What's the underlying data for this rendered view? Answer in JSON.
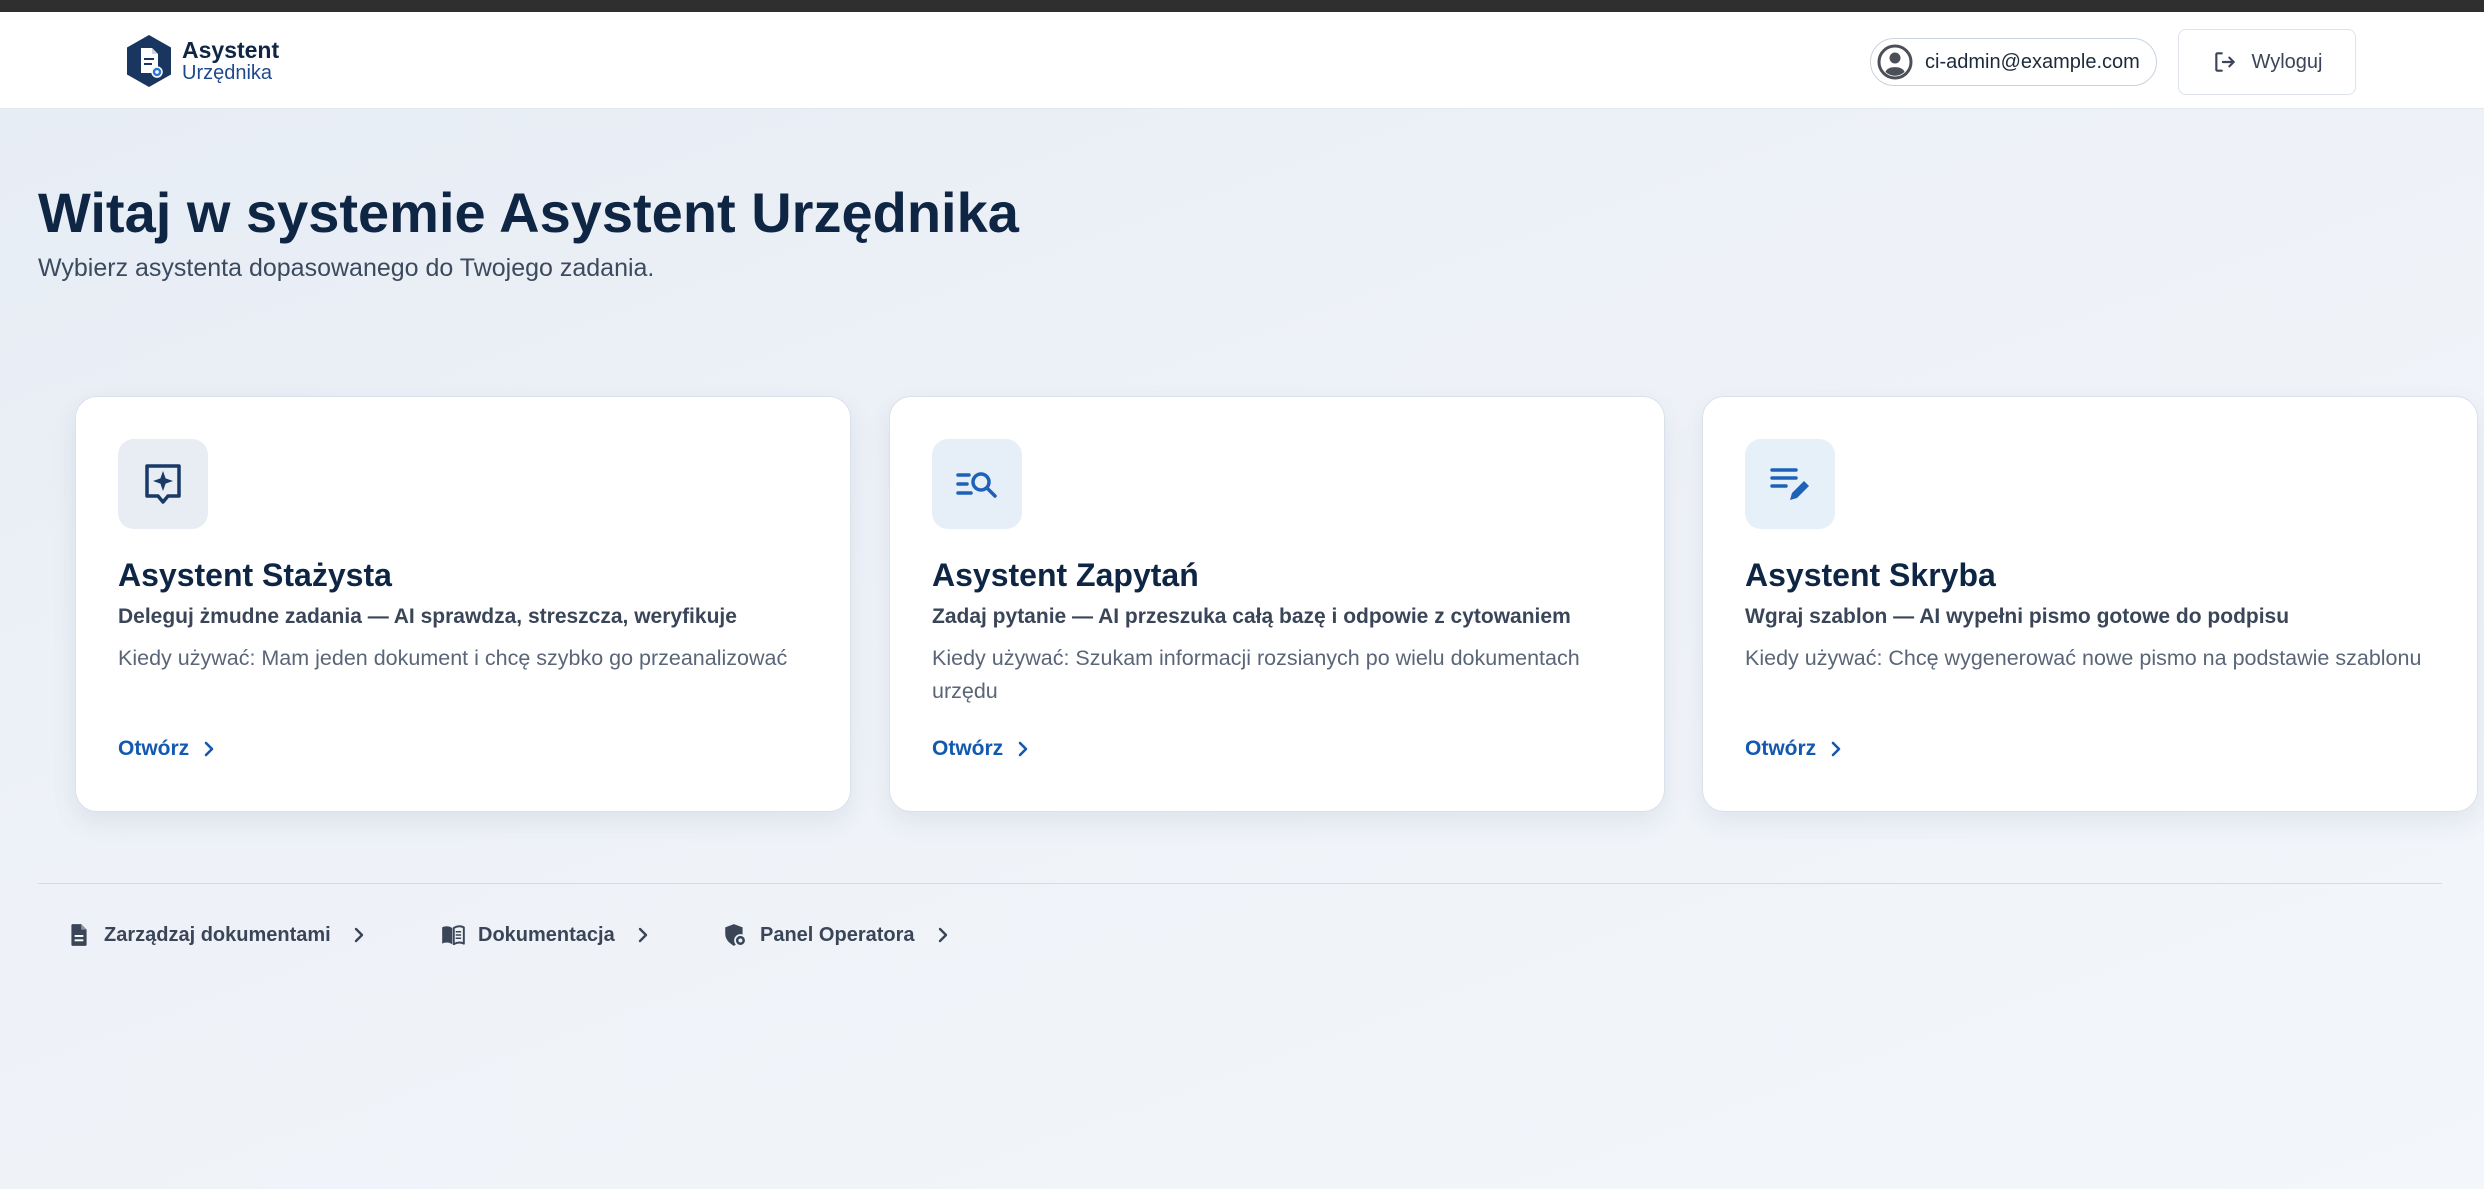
{
  "app": {
    "logo_line1": "Asystent",
    "logo_line2": "Urzędnika"
  },
  "header": {
    "user_email": "ci-admin@example.com",
    "logout_label": "Wyloguj"
  },
  "hero": {
    "title": "Witaj w systemie Asystent Urzędnika",
    "subtitle": "Wybierz asystenta dopasowanego do Twojego zadania."
  },
  "cards": [
    {
      "icon": "sparkle-bookmark-icon",
      "title": "Asystent Stażysta",
      "tagline": "Deleguj żmudne zadania — AI sprawdza, streszcza, weryfikuje",
      "description": "Kiedy używać: Mam jeden dokument i chcę szybko go przeanalizować",
      "open_label": "Otwórz"
    },
    {
      "icon": "search-list-icon",
      "title": "Asystent Zapytań",
      "tagline": "Zadaj pytanie — AI przeszuka całą bazę i odpowie z cytowaniem",
      "description": "Kiedy używać: Szukam informacji rozsianych po wielu dokumentach urzędu",
      "open_label": "Otwórz"
    },
    {
      "icon": "edit-note-icon",
      "title": "Asystent Skryba",
      "tagline": "Wgraj szablon — AI wypełni pismo gotowe do podpisu",
      "description": "Kiedy używać: Chcę wygenerować nowe pismo na podstawie szablonu",
      "open_label": "Otwórz"
    }
  ],
  "footer_links": [
    {
      "icon": "document-icon",
      "label": "Zarządzaj dokumentami"
    },
    {
      "icon": "book-icon",
      "label": "Dokumentacja"
    },
    {
      "icon": "shield-gear-icon",
      "label": "Panel Operatora"
    }
  ],
  "colors": {
    "brand_navy": "#0f2544",
    "accent_blue": "#1359b0",
    "icon_bg_1": "#e8edf4",
    "icon_bg_2": "#e6eff8",
    "icon_bg_3": "#e5f0f9"
  }
}
